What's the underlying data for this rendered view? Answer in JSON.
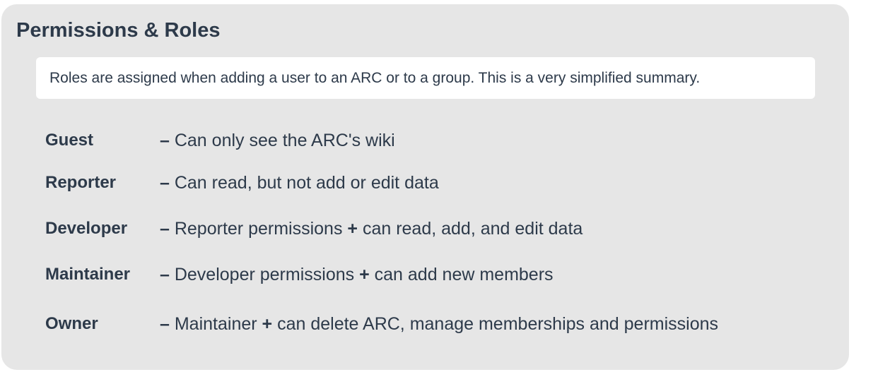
{
  "panel": {
    "title": "Permissions & Roles",
    "note": "Roles are assigned when adding a user to an ARC or to a group. This is a very simplified summary."
  },
  "roles": [
    {
      "name": "Guest",
      "dash": "–",
      "desc_before": " Can only see the ARC's wiki",
      "plus": "",
      "desc_after": ""
    },
    {
      "name": "Reporter",
      "dash": "–",
      "desc_before": " Can read, but not add or edit data",
      "plus": "",
      "desc_after": ""
    },
    {
      "name": "Developer",
      "dash": "–",
      "desc_before": " Reporter permissions ",
      "plus": "+",
      "desc_after": " can read, add, and edit data"
    },
    {
      "name": "Maintainer",
      "dash": "–",
      "desc_before": " Developer permissions ",
      "plus": "+",
      "desc_after": " can add new members"
    },
    {
      "name": "Owner",
      "dash": "–",
      "desc_before": " Maintainer ",
      "plus": "+",
      "desc_after": " can delete ARC, manage memberships and permissions"
    }
  ]
}
